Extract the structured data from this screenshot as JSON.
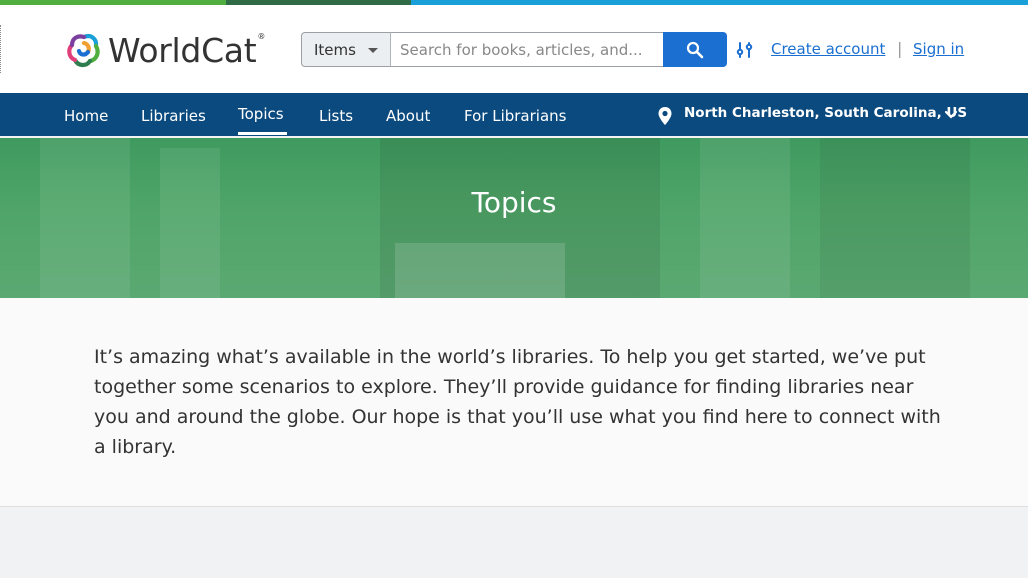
{
  "colors": {
    "topbar_green": "#4fae3d",
    "topbar_dark": "#2f6b45",
    "topbar_blue": "#1aa0d8",
    "nav_bg": "#0b4a7f",
    "link": "#1a6fd0",
    "hero_green": "#4ea468"
  },
  "header": {
    "logo_text": "WorldCat",
    "logo_reg": "®",
    "search": {
      "type_label": "Items",
      "placeholder": "Search for books, articles, and...",
      "button_icon": "search-icon"
    },
    "filter_icon": "advanced-search-icon",
    "create_account": "Create account",
    "divider": "|",
    "sign_in": "Sign in"
  },
  "nav": {
    "items": [
      {
        "label": "Home"
      },
      {
        "label": "Libraries"
      },
      {
        "label": "Topics"
      },
      {
        "label": "Lists"
      },
      {
        "label": "About"
      },
      {
        "label": "For Librarians"
      }
    ],
    "active_item": "Topics",
    "location": "North Charleston, South Carolina, US",
    "location_icon": "map-pin-icon",
    "location_chevron": "chevron-down-icon"
  },
  "hero": {
    "title": "Topics"
  },
  "intro": {
    "text": "It’s amazing what’s available in the world’s libraries. To help you get started, we’ve put together some scenarios to explore. They’ll provide guidance for finding libraries near you and around the globe. Our hope is that you’ll use what you find here to connect with a library."
  }
}
